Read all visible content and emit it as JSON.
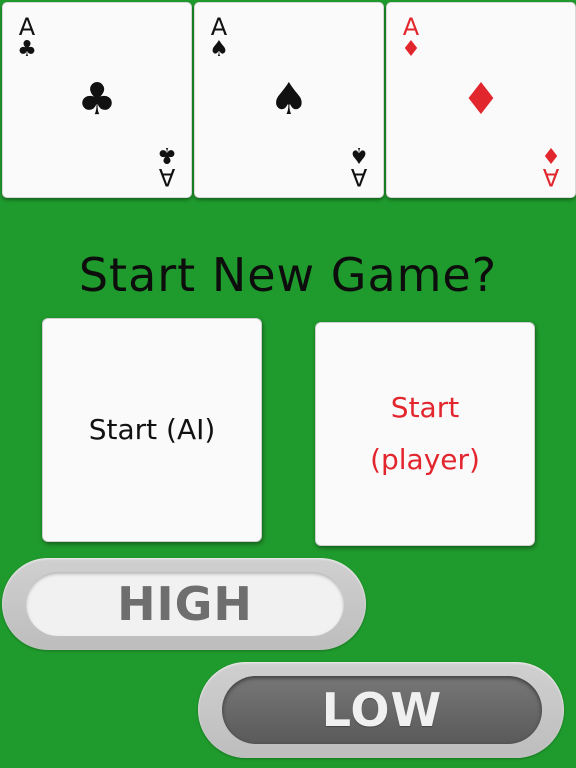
{
  "top_cards": [
    {
      "rank": "A",
      "suit": "♣",
      "suit_name": "clubs",
      "color": "#111111"
    },
    {
      "rank": "A",
      "suit": "♠",
      "suit_name": "spades",
      "color": "#111111"
    },
    {
      "rank": "A",
      "suit": "♦",
      "suit_name": "diamonds",
      "color": "#e2262e"
    }
  ],
  "headline": "Start New Game?",
  "start_ai": {
    "line1": "Start (AI)"
  },
  "start_player": {
    "line1": "Start",
    "line2": "(player)"
  },
  "high_button": "HIGH",
  "low_button": "LOW",
  "colors": {
    "table": "#1f9a2c",
    "red": "#e2262e"
  }
}
